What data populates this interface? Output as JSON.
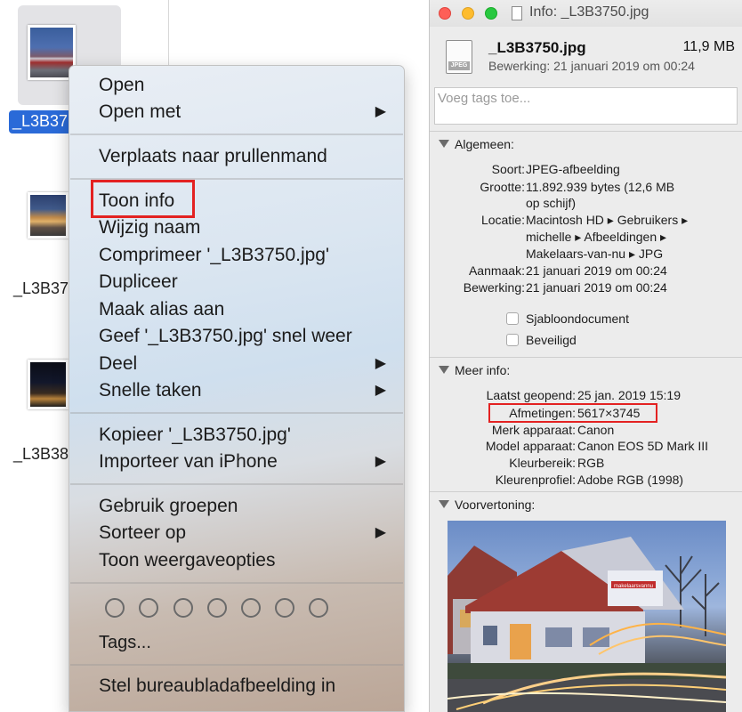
{
  "finder": {
    "files": [
      {
        "label": "_L3B37"
      },
      {
        "label": "_L3B37"
      },
      {
        "label": "_L3B38"
      }
    ]
  },
  "context_menu": {
    "groups": [
      [
        {
          "label": "Open"
        },
        {
          "label": "Open met",
          "submenu": true
        }
      ],
      [
        {
          "label": "Verplaats naar prullenmand"
        }
      ],
      [
        {
          "label": "Toon info",
          "highlighted": true
        },
        {
          "label": "Wijzig naam"
        },
        {
          "label": "Comprimeer '_L3B3750.jpg'"
        },
        {
          "label": "Dupliceer"
        },
        {
          "label": "Maak alias aan"
        },
        {
          "label": "Geef '_L3B3750.jpg' snel weer"
        },
        {
          "label": "Deel",
          "submenu": true
        },
        {
          "label": "Snelle taken",
          "submenu": true
        }
      ],
      [
        {
          "label": "Kopieer '_L3B3750.jpg'"
        },
        {
          "label": "Importeer van iPhone",
          "submenu": true
        }
      ],
      [
        {
          "label": "Gebruik groepen"
        },
        {
          "label": "Sorteer op",
          "submenu": true
        },
        {
          "label": "Toon weergaveopties"
        }
      ],
      [
        {
          "label": "Tags..."
        }
      ],
      [
        {
          "label": "Stel bureaubladafbeelding in"
        }
      ]
    ],
    "tag_colors_count": 7,
    "arrow_glyph": "▶"
  },
  "info": {
    "window_title": "Info: _L3B3750.jpg",
    "file_name": "_L3B3750.jpg",
    "file_size": "11,9 MB",
    "modified_line": "Bewerking: 21 januari 2019 om 00:24",
    "icon_badge": "JPEG",
    "tags_placeholder": "Voeg tags toe...",
    "general": {
      "header": "Algemeen:",
      "rows": [
        {
          "key": "Soort:",
          "value": [
            "JPEG-afbeelding"
          ]
        },
        {
          "key": "Grootte:",
          "value": [
            "11.892.939 bytes (12,6 MB",
            "op schijf)"
          ]
        },
        {
          "key": "Locatie:",
          "value": [
            "Macintosh HD ▸ Gebruikers ▸",
            "michelle ▸ Afbeeldingen ▸",
            "Makelaars-van-nu ▸ JPG"
          ]
        },
        {
          "key": "Aanmaak:",
          "value": [
            "21 januari 2019 om 00:24"
          ]
        },
        {
          "key": "Bewerking:",
          "value": [
            "21 januari 2019 om 00:24"
          ]
        }
      ],
      "checkboxes": [
        {
          "label": "Sjabloondocument",
          "checked": false
        },
        {
          "label": "Beveiligd",
          "checked": false
        }
      ]
    },
    "more_info": {
      "header": "Meer info:",
      "rows": [
        {
          "key": "Laatst geopend:",
          "value": "25 jan. 2019 15:19"
        },
        {
          "key": "Afmetingen:",
          "value": "5617×3745",
          "highlighted": true
        },
        {
          "key": "Merk apparaat:",
          "value": "Canon"
        },
        {
          "key": "Model apparaat:",
          "value": "Canon EOS 5D Mark III"
        },
        {
          "key": "Kleurbereik:",
          "value": "RGB"
        },
        {
          "key": "Kleurenprofiel:",
          "value": "Adobe RGB (1998)"
        }
      ]
    },
    "preview": {
      "header": "Voorvertoning:",
      "sign_text": "makelaarsvannu"
    }
  },
  "colors": {
    "highlight_box": "#e32222",
    "selection": "#2a6ad8",
    "traffic_red": "#fe5f57",
    "traffic_yellow": "#febc2e",
    "traffic_green": "#28c840"
  }
}
